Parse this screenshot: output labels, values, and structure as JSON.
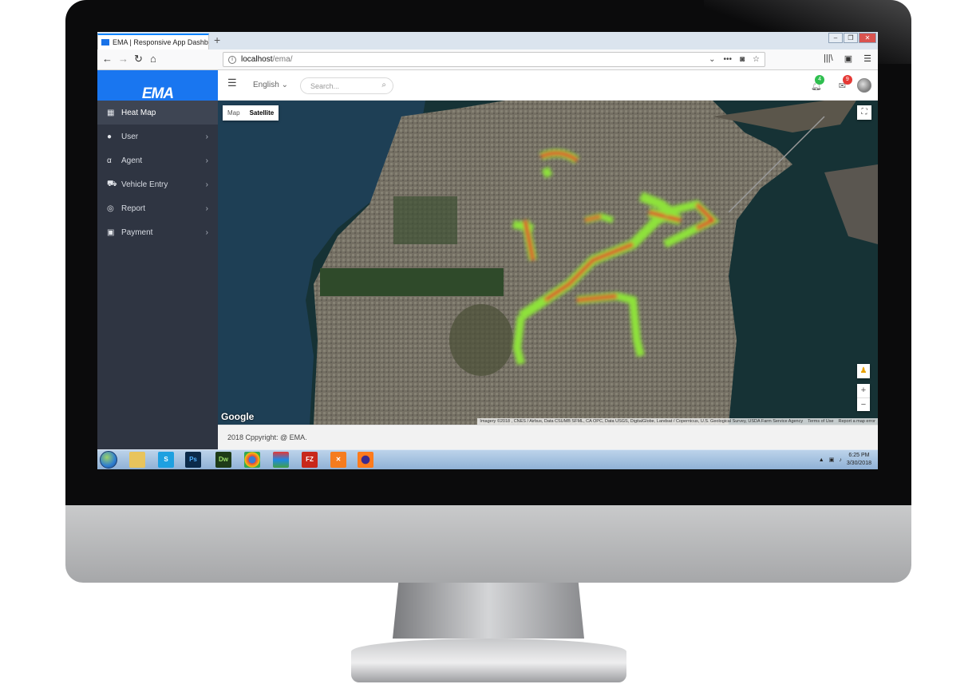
{
  "browser": {
    "tab_title": "EMA | Responsive App Dashbo",
    "url_host": "localhost",
    "url_path": "/ema/",
    "url_dots": "•••"
  },
  "app": {
    "brand": "EMA",
    "brand_color": "#1976f0",
    "sidebar_color": "#2f3542",
    "menu": [
      {
        "label": "Heat Map",
        "icon": "map-icon"
      },
      {
        "label": "User",
        "icon": "user-icon"
      },
      {
        "label": "Agent",
        "icon": "alpha-icon"
      },
      {
        "label": "Vehicle Entry",
        "icon": "car-icon"
      },
      {
        "label": "Report",
        "icon": "report-icon"
      },
      {
        "label": "Payment",
        "icon": "payment-icon"
      }
    ],
    "header": {
      "language": "English",
      "search_placeholder": "Search...",
      "notifications_count": "4",
      "messages_count": "9"
    },
    "map": {
      "type_map": "Map",
      "type_satellite": "Satellite",
      "selected_type": "Satellite",
      "google_logo": "Google",
      "attribution": "Imagery ©2018 , CNES / Airbus, Data CSUMB SFML, CA OPC, Data USGS, DigitalGlobe, Landsat / Copernicus, U.S. Geological Survey, USDA Farm Service Agency",
      "terms": "Terms of Use",
      "report": "Report a map error",
      "zoom_in": "+",
      "zoom_out": "−"
    },
    "footer": "2018 Cppyright: @ EMA."
  },
  "taskbar": {
    "apps": [
      "Ps",
      "Dw",
      "FZ"
    ],
    "time": "6:25 PM",
    "date": "3/30/2018"
  }
}
